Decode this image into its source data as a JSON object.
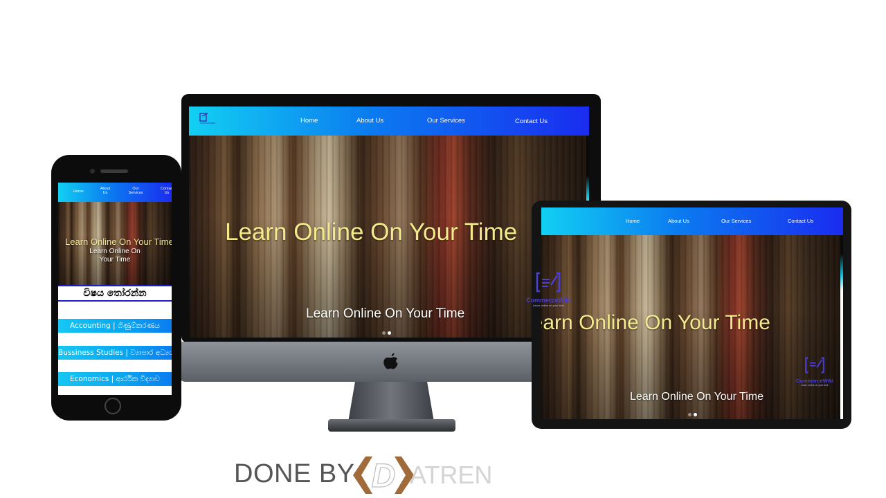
{
  "colors": {
    "nav_gradient_start": "#12d0f2",
    "nav_gradient_end": "#1a2cf0",
    "headline": "#f2ea8c",
    "subline": "#ffffff",
    "logo_purple": "#4a3fd0",
    "footer_text": "#555555",
    "brand_mark": "#a06a3a"
  },
  "site": {
    "nav": {
      "home": "Home",
      "about": "About Us",
      "services": "Our Services",
      "contact": "Contact Us"
    },
    "hero": {
      "headline": "Learn Online On Your Time",
      "subline": "Learn Online On Your Time",
      "logo_name": "CommerceWiki",
      "logo_tagline": "Learn online on your time",
      "logo_icon": "document-pen-icon"
    },
    "phone_nav": {
      "home": "Home",
      "about": "About Us",
      "services": "Our Services",
      "contact": "Contact Us"
    },
    "phone_subline": "Learn Online On Your Time",
    "subjects_heading": "විෂය තෝරන්න",
    "subjects": [
      "Accounting | ගිණුම්කරණය",
      "Bussiness Studies | ව්‍යාපාර අධ්‍යයනය",
      "Economics | ආර්ථික විද්‍යාව"
    ]
  },
  "devices": {
    "desktop_brand_icon": "apple-logo-icon"
  },
  "footer": {
    "done_by": "DONE BY",
    "brand_letter": "D",
    "brand_rest": "ATREN"
  }
}
